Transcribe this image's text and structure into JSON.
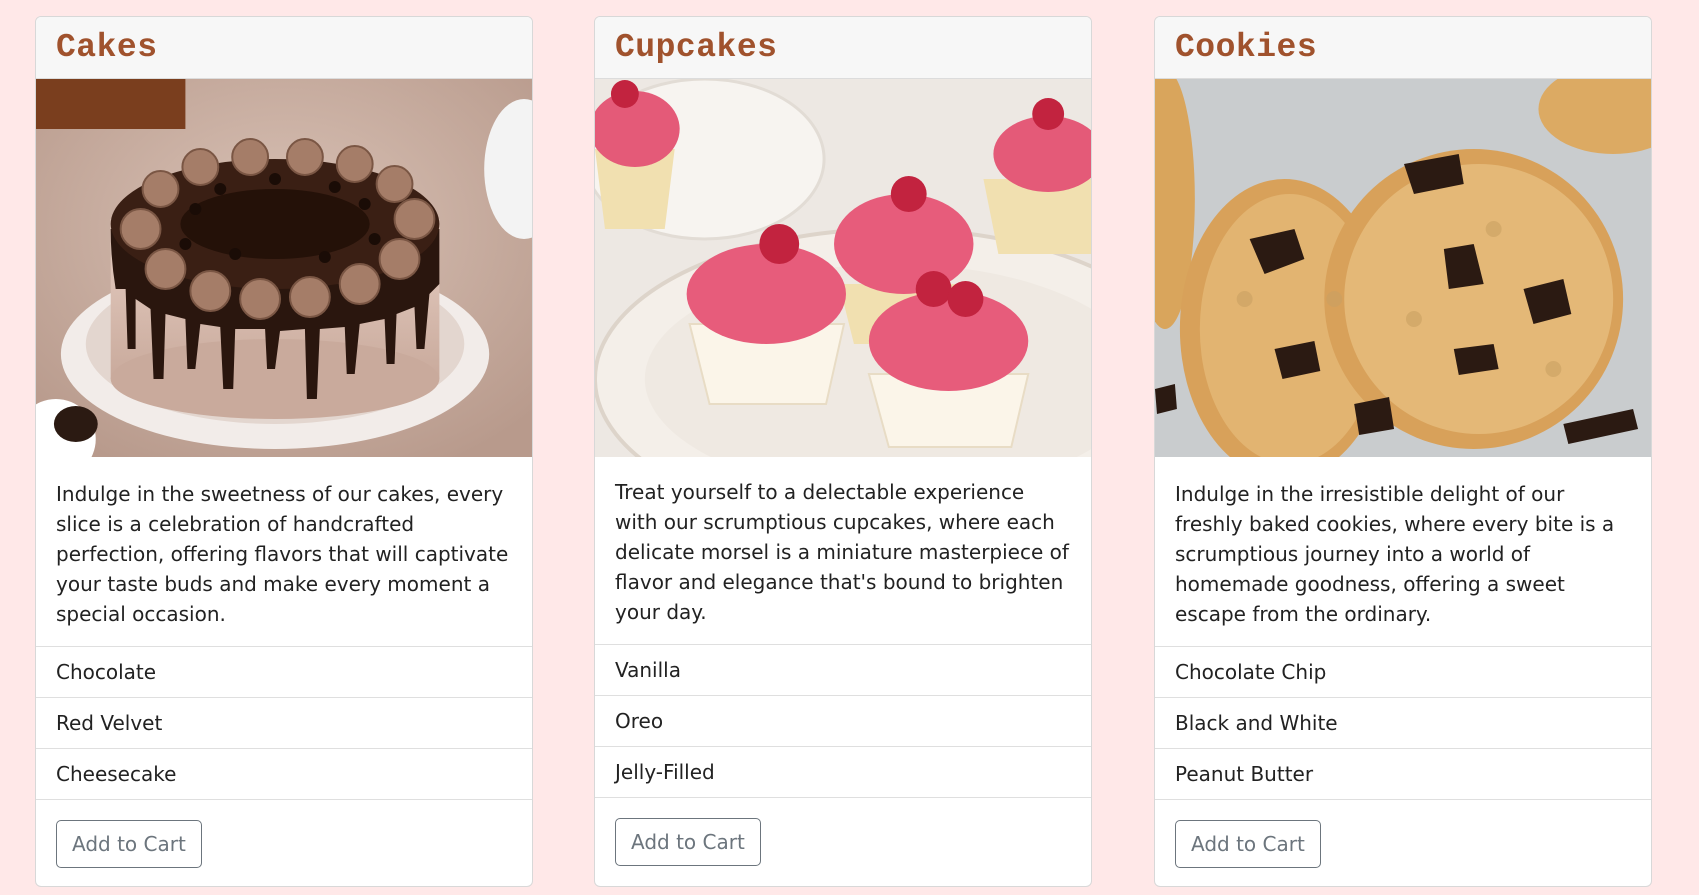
{
  "cards": [
    {
      "title": "Cakes",
      "image_alt": "chocolate drip cake",
      "description": "Indulge in the sweetness of our cakes, every slice is a celebration of handcrafted perfection, offering flavors that will captivate your taste buds and make every moment a special occasion.",
      "flavors": [
        "Chocolate",
        "Red Velvet",
        "Cheesecake"
      ],
      "button_label": "Add to Cart"
    },
    {
      "title": "Cupcakes",
      "image_alt": "raspberry cupcakes",
      "description": "Treat yourself to a delectable experience with our scrumptious cupcakes, where each delicate morsel is a miniature masterpiece of flavor and elegance that's bound to brighten your day.",
      "flavors": [
        "Vanilla",
        "Oreo",
        "Jelly-Filled"
      ],
      "button_label": "Add to Cart"
    },
    {
      "title": "Cookies",
      "image_alt": "chocolate chip cookies",
      "description": "Indulge in the irresistible delight of our freshly baked cookies, where every bite is a scrumptious journey into a world of homemade goodness, offering a sweet escape from the ordinary.",
      "flavors": [
        "Chocolate Chip",
        "Black and White",
        "Peanut Butter"
      ],
      "button_label": "Add to Cart"
    }
  ],
  "colors": {
    "page_background": "#ffe8e8",
    "title": "#a0522d",
    "button": "#6c757d"
  }
}
